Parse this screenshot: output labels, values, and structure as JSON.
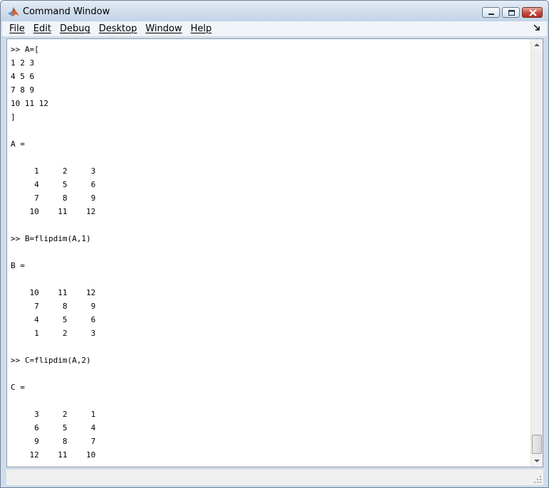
{
  "window": {
    "title": "Command Window",
    "controls": [
      "minimize",
      "maximize",
      "close"
    ]
  },
  "menubar": {
    "items": [
      "File",
      "Edit",
      "Debug",
      "Desktop",
      "Window",
      "Help"
    ]
  },
  "console": {
    "lines": [
      ">> A=[",
      "1 2 3",
      "4 5 6",
      "7 8 9",
      "10 11 12",
      "]",
      "",
      "A =",
      "",
      "     1     2     3",
      "     4     5     6",
      "     7     8     9",
      "    10    11    12",
      "",
      ">> B=flipdim(A,1)",
      "",
      "B =",
      "",
      "    10    11    12",
      "     7     8     9",
      "     4     5     6",
      "     1     2     3",
      "",
      ">> C=flipdim(A,2)",
      "",
      "C =",
      "",
      "     3     2     1",
      "     6     5     4",
      "     9     8     7",
      "    12    11    10"
    ]
  },
  "icons": {
    "app": "matlab-logo-icon",
    "undock": "undock-arrow-icon",
    "scroll_up": "arrow-up-icon",
    "scroll_down": "arrow-down-icon",
    "grip": "resize-grip-icon"
  },
  "colors": {
    "titlebar": "#d3e0ee",
    "close_button": "#c4493a",
    "console_bg": "#ffffff",
    "text": "#000000"
  }
}
